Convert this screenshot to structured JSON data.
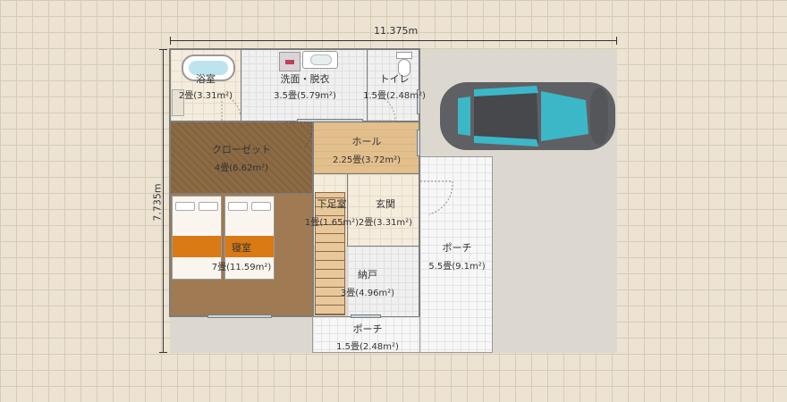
{
  "dimensions": {
    "width": "11.375m",
    "height": "7.735m"
  },
  "rooms": {
    "bath": {
      "name": "浴室",
      "area": "2畳(3.31m²)"
    },
    "washroom": {
      "name": "洗面・脱衣",
      "area": "3.5畳(5.79m²)"
    },
    "toilet": {
      "name": "トイレ",
      "area": "1.5畳(2.48m²)"
    },
    "closet": {
      "name": "クローゼット",
      "area": "4畳(6.62m²)"
    },
    "hall": {
      "name": "ホール",
      "area": "2.25畳(3.72m²)"
    },
    "shoe_room": {
      "name": "下足室",
      "area": "1畳(1.65m²)"
    },
    "entrance": {
      "name": "玄関",
      "area": "2畳(3.31m²)"
    },
    "bedroom": {
      "name": "寝室",
      "area": "7畳(11.59m²)"
    },
    "storage": {
      "name": "納戸",
      "area": "3畳(4.96m²)"
    },
    "porch_large": {
      "name": "ポーチ",
      "area": "5.5畳(9.1m²)"
    },
    "porch_small": {
      "name": "ポーチ",
      "area": "1.5畳(2.48m²)"
    }
  },
  "colors": {
    "car_body": "#5f6063",
    "car_glass": "#3cb7c8",
    "bedspread": "#d97a14",
    "wall": "#7d7d7d"
  },
  "icons": [
    "bathtub-icon",
    "washbasin-icon",
    "toilet-icon",
    "car-icon",
    "bed-icon",
    "stairs-icon"
  ]
}
